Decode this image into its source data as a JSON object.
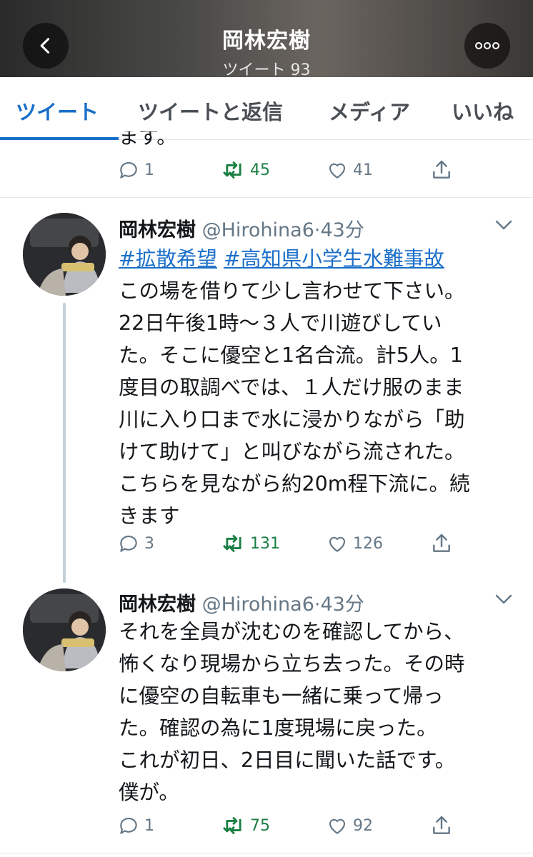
{
  "header": {
    "title": "岡林宏樹",
    "subtitle": "ツイート 93"
  },
  "tabs": [
    {
      "label": "ツイート"
    },
    {
      "label": "ツイートと返信"
    },
    {
      "label": "メディア"
    },
    {
      "label": "いいね"
    }
  ],
  "prev_tweet": {
    "partial_text": "ます。",
    "replies": "1",
    "retweets": "45",
    "likes": "41"
  },
  "tweets": [
    {
      "name": "岡林宏樹",
      "handle": "@Hirohina6",
      "time": "·43分",
      "hashtags": [
        "#拡散希望",
        "#高知県小学生水難事故"
      ],
      "lines": [
        "この場を借りて少し言わせて下さい。",
        "22日午後1時〜３人で川遊びしてい",
        "た。そこに優空と1名合流。計5人。1",
        "度目の取調べでは、１人だけ服のまま",
        "川に入り口まで水に浸かりながら「助",
        "けて助けて」と叫びながら流された。",
        "こちらを見ながら約20m程下流に。続",
        "きます"
      ],
      "replies": "3",
      "retweets": "131",
      "likes": "126"
    },
    {
      "name": "岡林宏樹",
      "handle": "@Hirohina6",
      "time": "·43分",
      "lines": [
        "それを全員が沈むのを確認してから、",
        "怖くなり現場から立ち去った。その時",
        "に優空の自転車も一緒に乗って帰っ",
        "た。確認の為に1度現場に戻った。",
        "これが初日、2日目に聞いた話です。",
        "僕が。"
      ],
      "replies": "1",
      "retweets": "75",
      "likes": "92"
    }
  ],
  "colors": {
    "accent": "#1b6fc9",
    "retweet": "#1a7f43",
    "muted": "#657786"
  }
}
